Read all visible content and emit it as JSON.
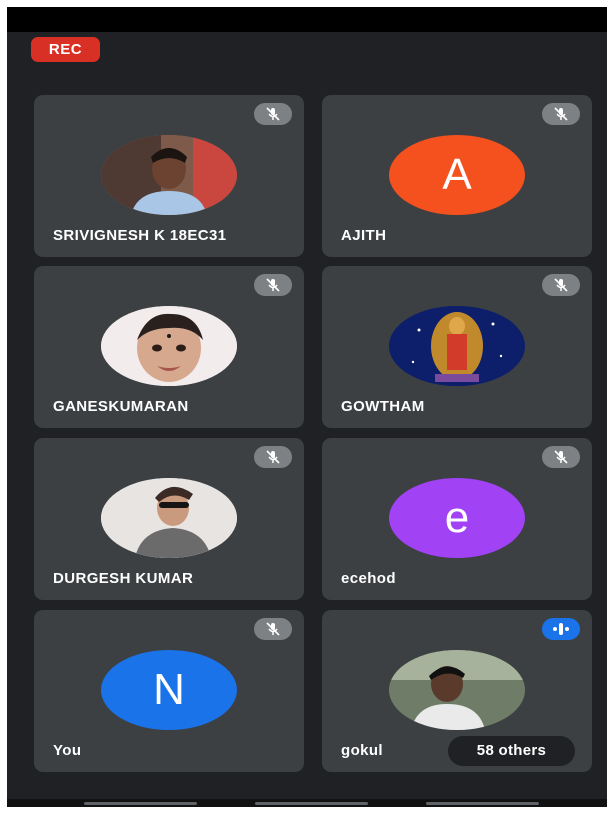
{
  "recording": {
    "label": "REC",
    "color": "#d93025"
  },
  "participants": [
    {
      "name": "SRIVIGNESH K 18EC31",
      "avatar": "photo",
      "mic": "muted"
    },
    {
      "name": "AJITH",
      "avatar": "initial",
      "initial": "A",
      "color": "#f4511e",
      "mic": "muted"
    },
    {
      "name": "GANESKUMARAN",
      "avatar": "photo",
      "mic": "muted"
    },
    {
      "name": "GOWTHAM",
      "avatar": "photo",
      "mic": "muted"
    },
    {
      "name": "DURGESH KUMAR",
      "avatar": "photo",
      "mic": "muted"
    },
    {
      "name": "ecehod",
      "avatar": "initial",
      "initial": "e",
      "color": "#a142f4",
      "mic": "muted"
    },
    {
      "name": "You",
      "avatar": "initial",
      "initial": "N",
      "color": "#1a73e8",
      "mic": "muted"
    },
    {
      "name": "gokul",
      "avatar": "photo",
      "mic": "speaking"
    }
  ],
  "others_label": "58 others",
  "icons": {
    "muted": "mic-off-icon",
    "speaking": "audio-level-icon"
  }
}
